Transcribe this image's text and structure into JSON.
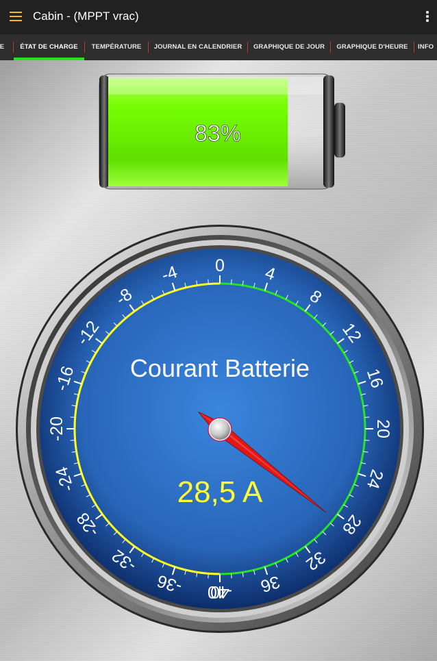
{
  "appbar": {
    "title": "Cabin - (MPPT vrac)",
    "menu_icon": "menu-icon",
    "overflow_icon": "more-vert-icon"
  },
  "tabs": [
    {
      "label": "E"
    },
    {
      "label": "ÉTAT DE CHARGE",
      "selected": true
    },
    {
      "label": "TEMPÉRATURE"
    },
    {
      "label": "JOURNAL EN CALENDRIER"
    },
    {
      "label": "GRAPHIQUE DE JOUR"
    },
    {
      "label": "GRAPHIQUE D'HEURE"
    },
    {
      "label": "INFO"
    }
  ],
  "colors": {
    "accent_green": "#1ee51e",
    "menu_icon": "#f2b825",
    "tab_separator": "#c0392b",
    "gauge_face": "#2a6cc0",
    "value_text": "#ffff33",
    "needle": "#e01818"
  },
  "battery": {
    "percent_label": "83%",
    "level": 0.83
  },
  "gauge": {
    "title": "Courant Batterie",
    "value_label": "28,5 A",
    "value": 28.5,
    "min": -40,
    "max": 40,
    "tick_labels": [
      "-40",
      "-36",
      "-32",
      "-28",
      "-24",
      "-20",
      "-16",
      "-12",
      "-8",
      "-4",
      "0",
      "4",
      "8",
      "12",
      "16",
      "20",
      "24",
      "28",
      "32",
      "36",
      "40"
    ],
    "negative_zone_color": "#ffff1a",
    "positive_zone_color": "#22e622"
  }
}
